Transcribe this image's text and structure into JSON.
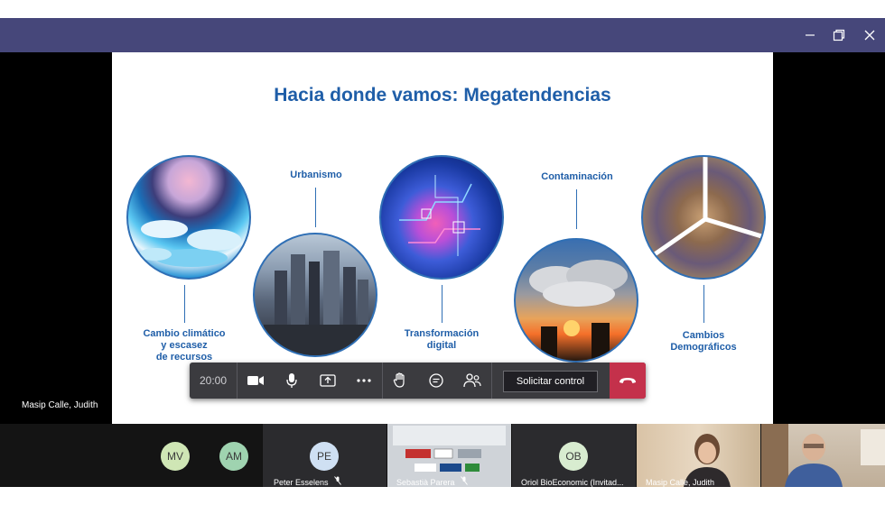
{
  "window": {
    "controls": [
      "minimize-icon",
      "restore-icon",
      "close-icon"
    ],
    "title_bar_color": "#46477a"
  },
  "presenter": {
    "name": "Masip Calle, Judith"
  },
  "slide": {
    "title": "Hacia donde vamos: Megatendencias",
    "accent_color": "#1f5ea8",
    "items": [
      {
        "label": "Cambio climático\ny escasez\nde recursos",
        "image": "ice-glacier"
      },
      {
        "label": "Urbanismo",
        "image": "city-skyline"
      },
      {
        "label": "Transformación\ndigital",
        "image": "digital-circuit"
      },
      {
        "label": "Contaminación",
        "image": "smoke-stacks"
      },
      {
        "label": "Cambios\nDemográficos",
        "image": "crowd-pie"
      }
    ]
  },
  "toolbar": {
    "timer": "20:00",
    "buttons": [
      "camera-icon",
      "microphone-icon",
      "share-screen-icon",
      "more-options-icon",
      "raise-hand-icon",
      "chat-icon",
      "participants-icon"
    ],
    "control_label": "Solicitar control",
    "hangup_icon": "hang-up-icon",
    "hangup_color": "#c4314b"
  },
  "participants": {
    "avatars_group": [
      {
        "initials": "MV",
        "color": "#cfe6b5"
      },
      {
        "initials": "AM",
        "color": "#9fd3b0"
      }
    ],
    "tiles": [
      {
        "initials": "PE",
        "name": "Peter Esselens",
        "color": "#cfe0f3",
        "muted": true
      },
      {
        "name": "Sebastià Parera",
        "muted": true
      },
      {
        "initials": "OB",
        "name": "Oriol BioEconomic (Invitad...",
        "color": "#d8ecd0"
      },
      {
        "name": "Masip Calle, Judith"
      },
      {
        "name": ""
      }
    ]
  }
}
